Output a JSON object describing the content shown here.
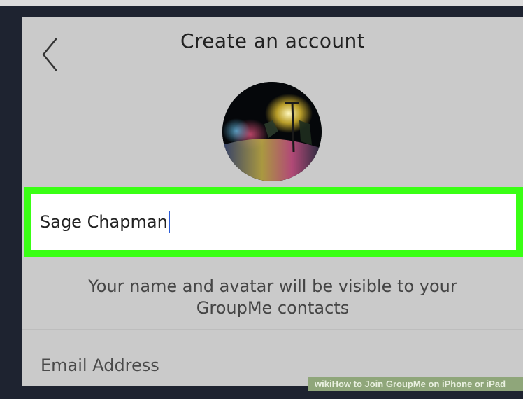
{
  "screen": {
    "title": "Create an account"
  },
  "name_field": {
    "value": "Sage Chapman"
  },
  "helper_text": {
    "line1": "Your name and avatar will be visible to your",
    "line2": "GroupMe contacts"
  },
  "email_field": {
    "placeholder": "Email Address"
  },
  "watermark": {
    "text": "wikiHow to Join GroupMe on iPhone or iPad"
  },
  "icons": {
    "back": "chevron-left-icon"
  },
  "colors": {
    "highlight": "#39ff14",
    "caret": "#2a5bd7",
    "screen_bg": "#cacaca"
  }
}
